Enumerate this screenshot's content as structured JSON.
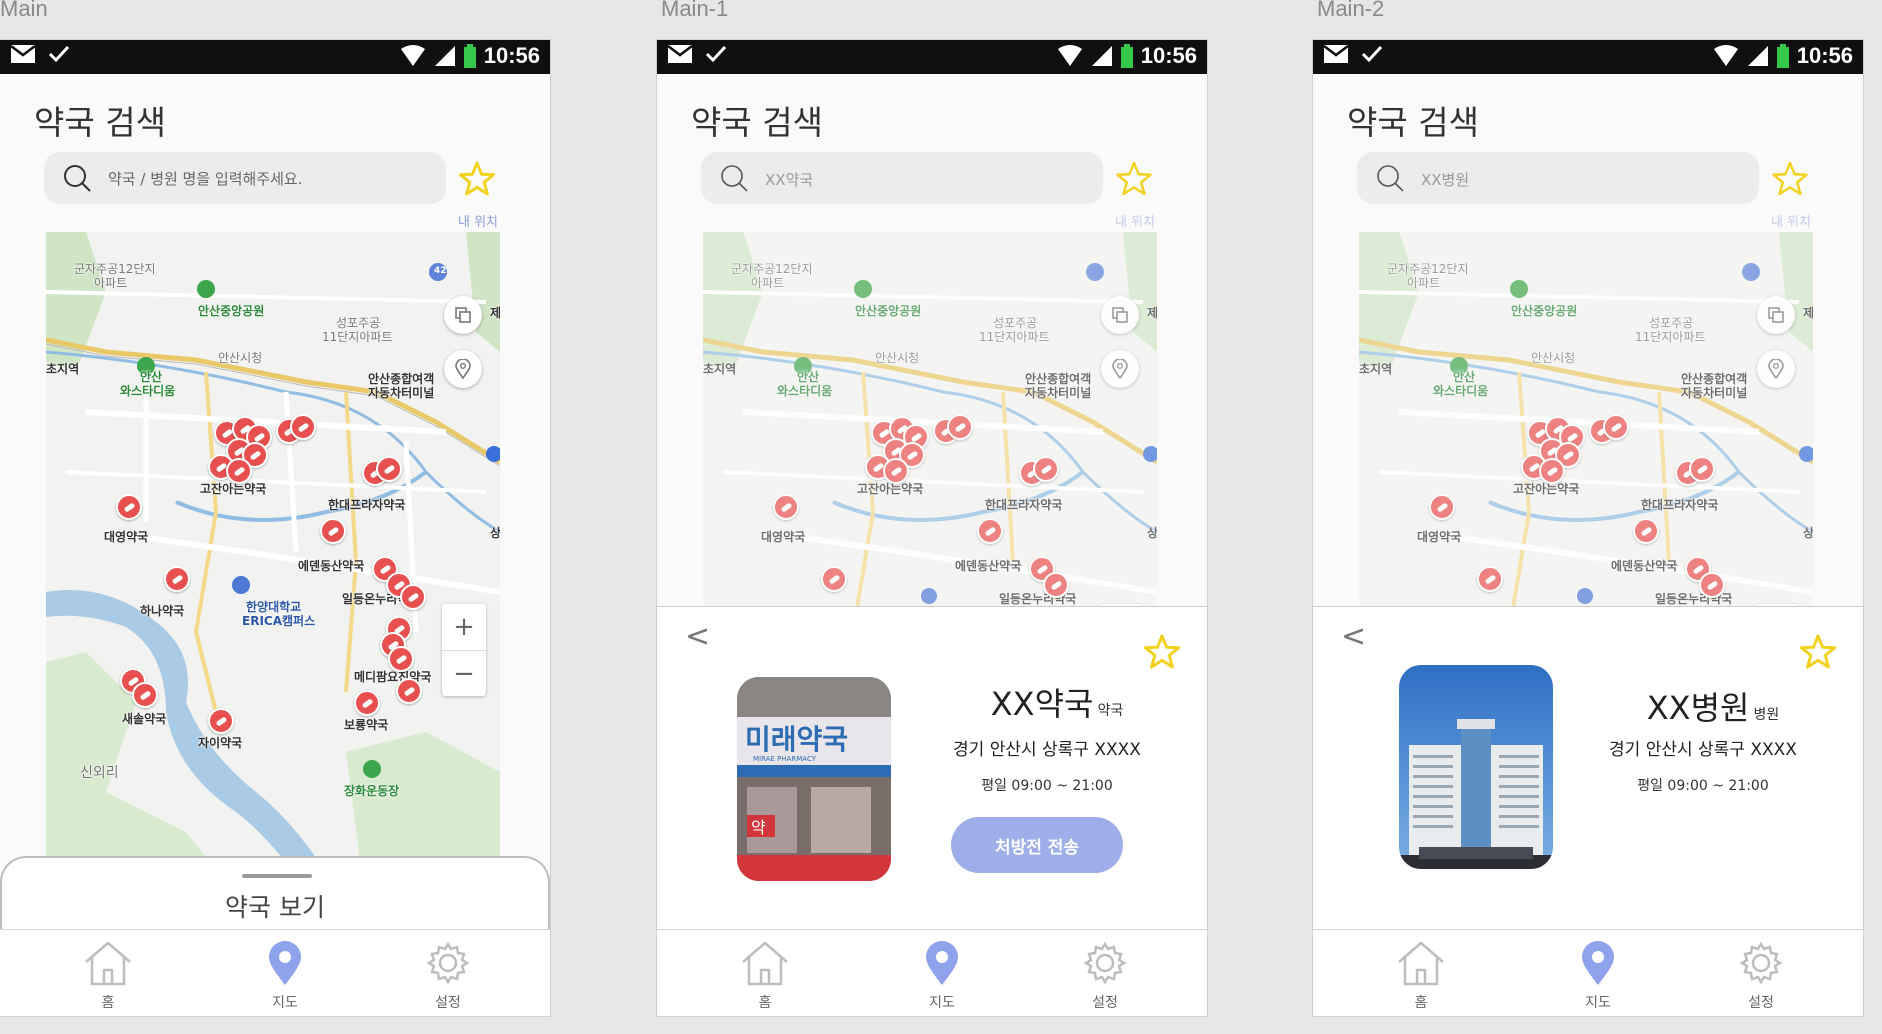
{
  "artboards": [
    "Main",
    "Main-1",
    "Main-2"
  ],
  "status": {
    "time": "10:56"
  },
  "app": {
    "title": "약국 검색",
    "my_location": "내 위치"
  },
  "search": {
    "main_placeholder": "약국 / 병원 명을 입력해주세요.",
    "main1_value": "XX약국",
    "main2_value": "XX병원"
  },
  "map": {
    "labels": {
      "apt1": "군자주공12단지",
      "apt1b": "아파트",
      "park": "안산중앙공원",
      "apt2": "성포주공",
      "apt2b": "11단지아파트",
      "cityhall": "안산시청",
      "station": "초지역",
      "stadium1": "안산",
      "stadium2": "와스타디움",
      "terminal1": "안산종합여객",
      "terminal2": "자동차터미널",
      "ph_gojan": "고잔아는약국",
      "ph_handae": "한대프라자약국",
      "ph_daeyoung": "대영약국",
      "ph_eden": "에덴동산약국",
      "ph_ildeung": "일등온누리약국",
      "ph_hana": "하나약국",
      "univ1": "한양대학교",
      "univ2": "ERICA캠퍼스",
      "ph_medi": "메디팜요진약국",
      "ph_saesol": "새솔약국",
      "ph_jai": "자이약국",
      "ph_boryong": "보룡약국",
      "sinoe": "신외리",
      "jangwha": "장화운동장",
      "road42": "42",
      "edge_je": "제",
      "edge_sang": "상"
    }
  },
  "bottom_sheet": {
    "title": "약국 보기"
  },
  "tabs": [
    {
      "label": "홈",
      "icon": "home-icon"
    },
    {
      "label": "지도",
      "icon": "map-pin-icon"
    },
    {
      "label": "설정",
      "icon": "gear-icon"
    }
  ],
  "pharmacy_card": {
    "back": "<",
    "name": "XX약국",
    "type": "약국",
    "address": "경기 안산시 상록구 XXXX",
    "hours": "평일 09:00 ~ 21:00",
    "button": "처방전 전송",
    "sign": "미래약국",
    "sign_sub": "MIRAE PHARMACY",
    "sign_small": "약"
  },
  "hospital_card": {
    "back": "<",
    "name": "XX병원",
    "type": "병원",
    "address": "경기 안산시 상록구 XXXX",
    "hours": "평일 09:00 ~ 21:00"
  },
  "colors": {
    "accent": "#9eaee8",
    "pin": "#e8504f",
    "star": "#f2d21f",
    "tab_active": "#8fa3ec",
    "tab_inactive": "#bdbdbd"
  }
}
